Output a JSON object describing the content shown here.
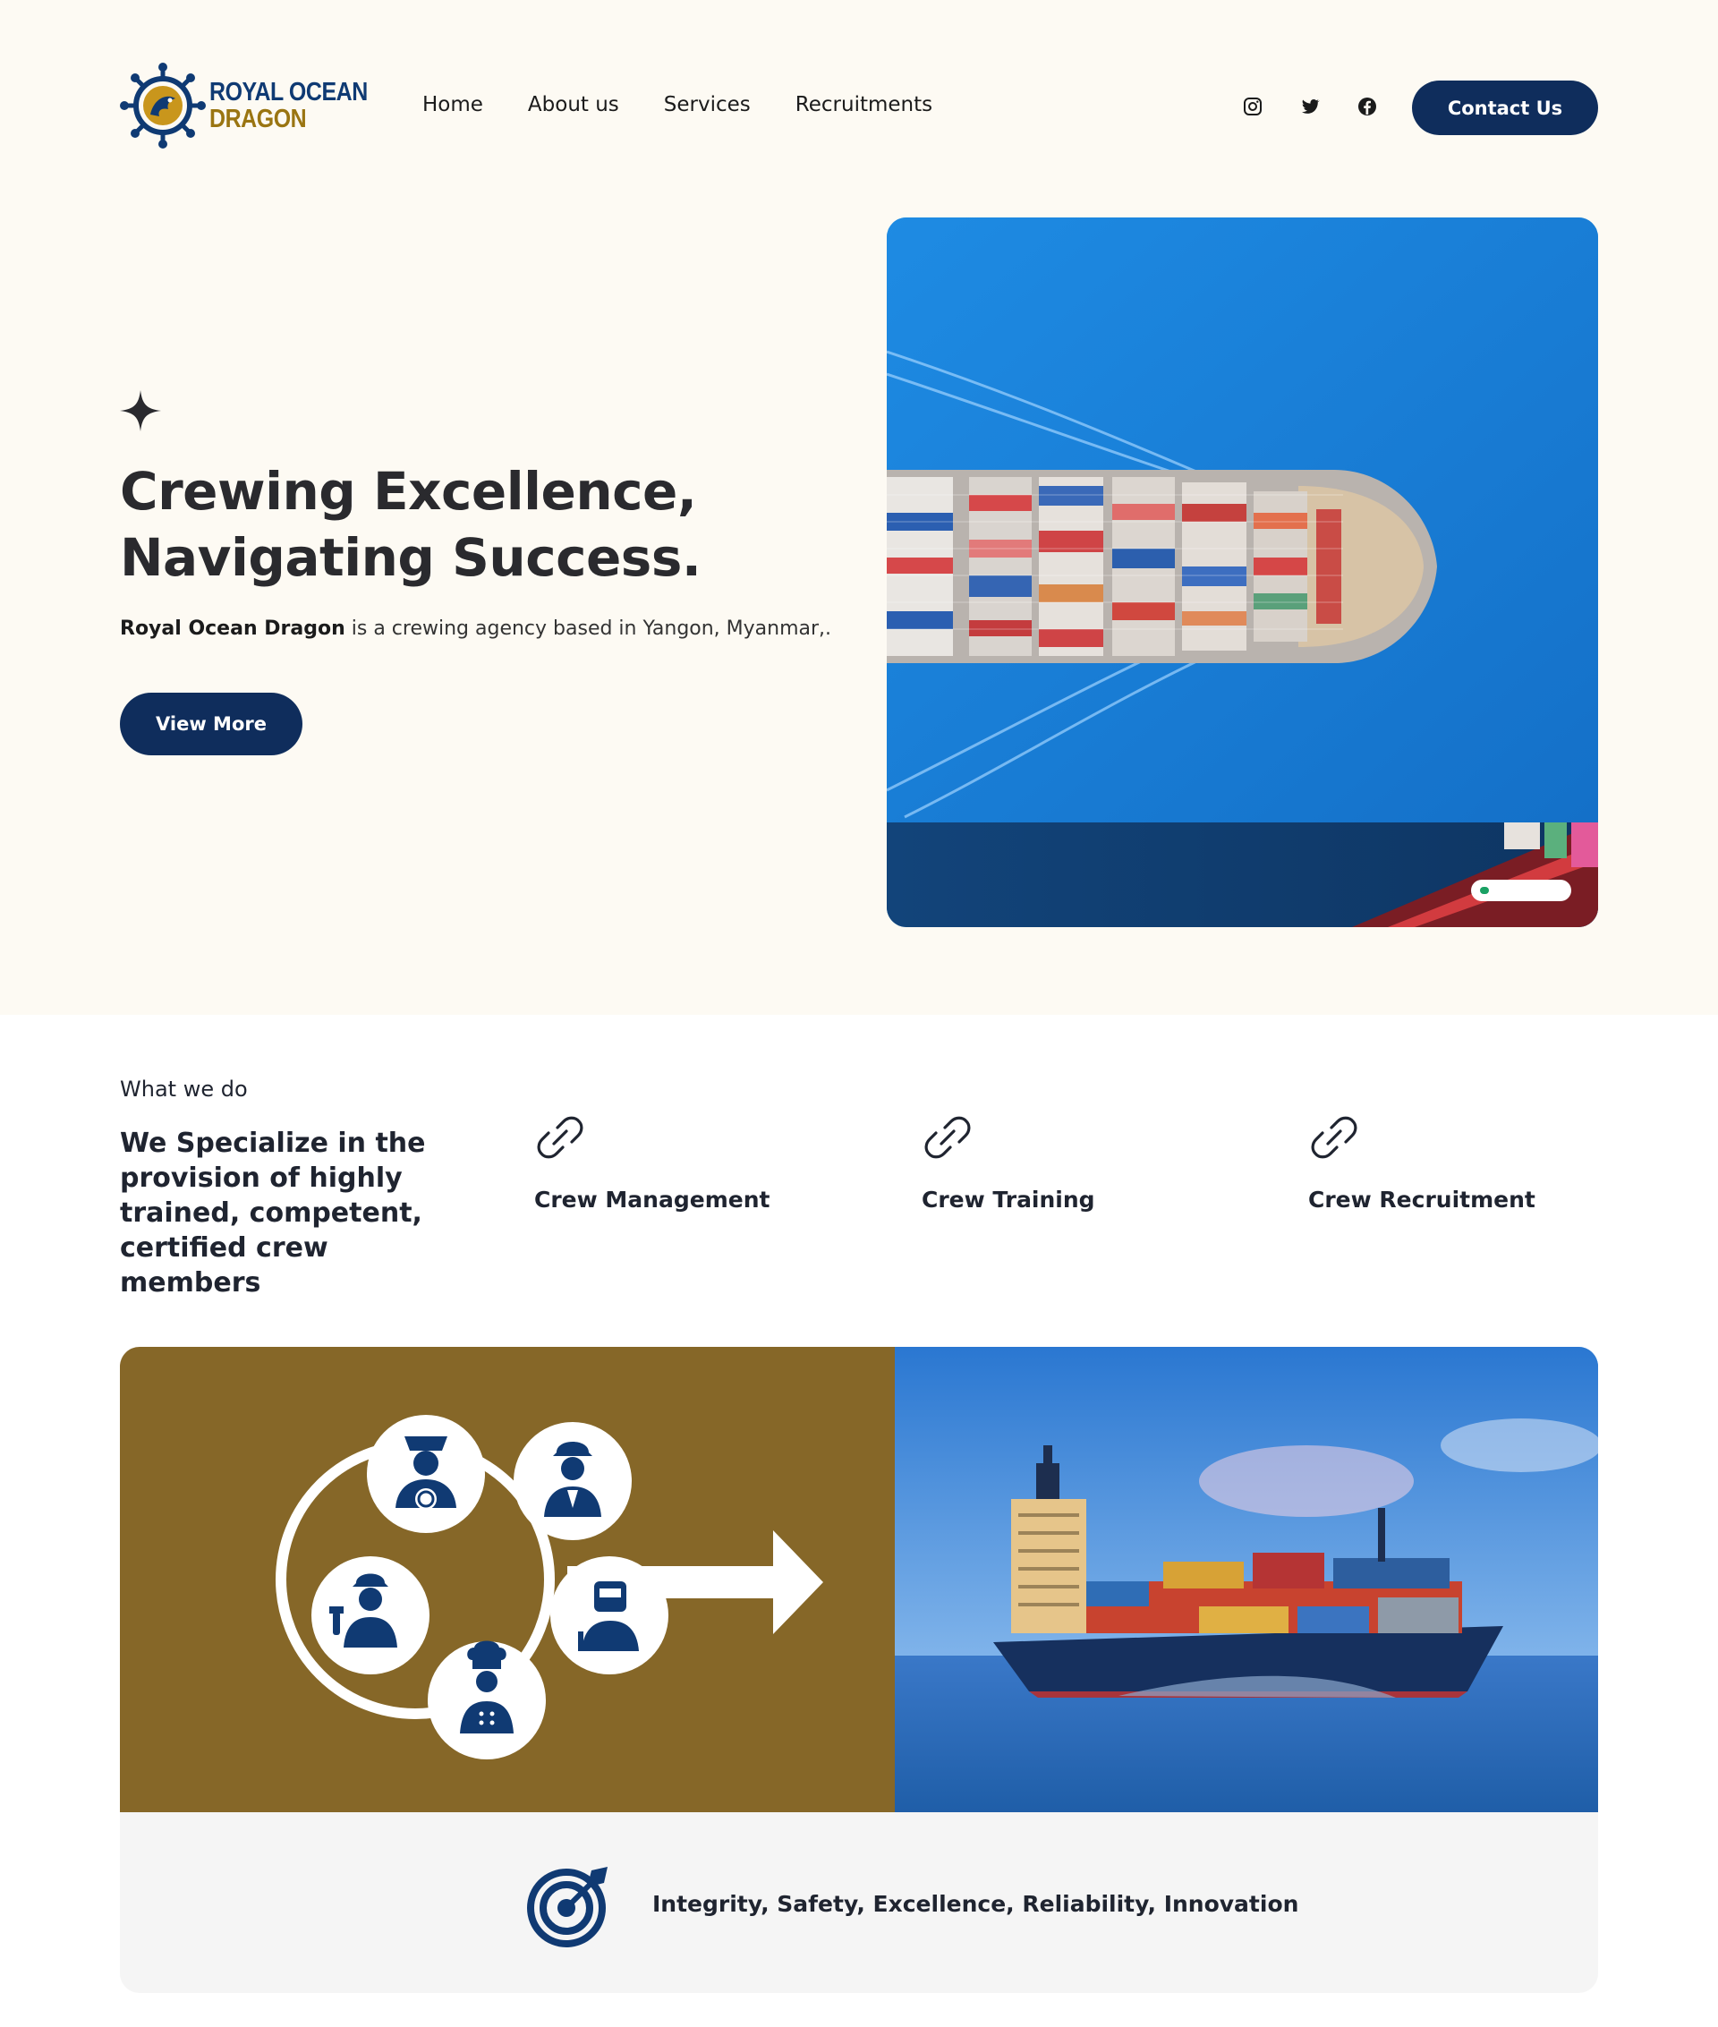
{
  "brand": {
    "name_line1": "ROYAL OCEAN",
    "name_line2": "DRAGON",
    "primary_color": "#0f2d5c",
    "gold_color": "#9a7512"
  },
  "nav": {
    "items": [
      "Home",
      "About us",
      "Services",
      "Recruitments"
    ]
  },
  "socials": [
    "instagram-icon",
    "twitter-icon",
    "facebook-icon"
  ],
  "header": {
    "contact_label": "Contact Us"
  },
  "hero": {
    "title_line1": "Crewing Excellence,",
    "title_line2": "Navigating Success.",
    "subtitle_strong": "Royal Ocean Dragon",
    "subtitle_rest": " is a crewing agency based in Yangon, Myanmar,.",
    "cta_label": "View More",
    "slider": {
      "active_index": 0
    }
  },
  "what_we_do": {
    "label": "What we do",
    "title": "We Specialize in the provision of highly trained, competent, certified crew members",
    "services": [
      "Crew Management",
      "Crew Training",
      "Crew Recruitment"
    ]
  },
  "values": {
    "text": "Integrity, Safety, Excellence, Reliability, Innovation"
  }
}
